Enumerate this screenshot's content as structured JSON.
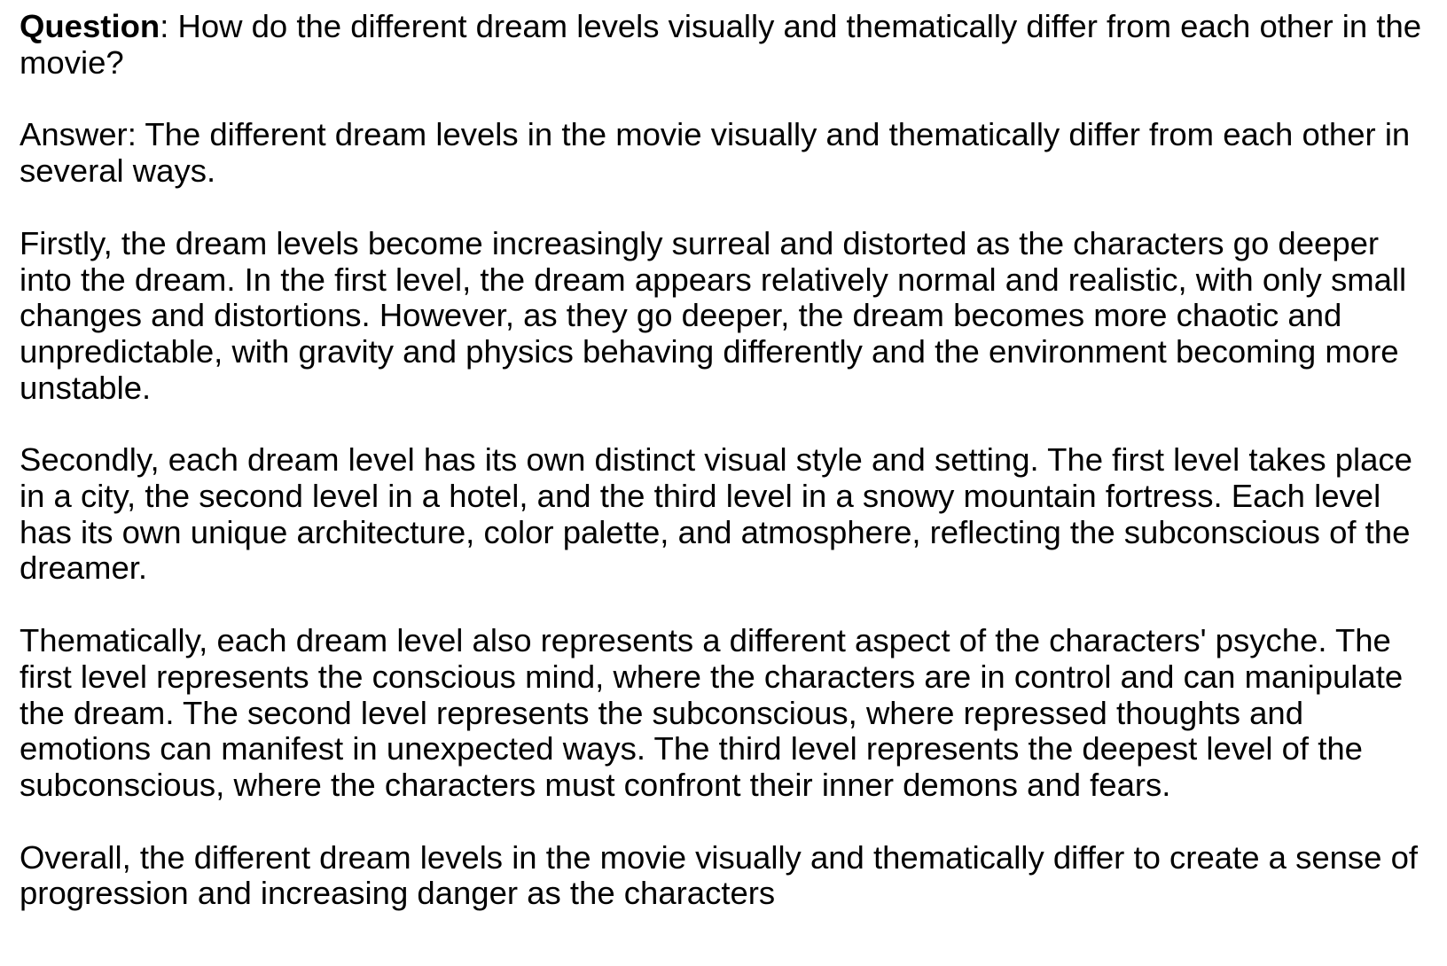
{
  "question": {
    "label": "Question",
    "text": ": How do the different dream levels visually and thematically differ from each other in the movie?"
  },
  "answer": {
    "intro": "Answer:  The different dream levels in the movie visually and thematically differ from each other in several ways.",
    "paragraphs": [
      "Firstly, the dream levels become increasingly surreal and distorted as the characters go deeper into the dream. In the first level, the dream appears relatively normal and realistic, with only small changes and distortions. However, as they go deeper, the dream becomes more chaotic and unpredictable, with gravity and physics behaving differently and the environment becoming more unstable.",
      "Secondly, each dream level has its own distinct visual style and setting. The first level takes place in a city, the second level in a hotel, and the third level in a snowy mountain fortress. Each level has its own unique architecture, color palette, and atmosphere, reflecting the subconscious of the dreamer.",
      "Thematically, each dream level also represents a different aspect of the characters' psyche. The first level represents the conscious mind, where the characters are in control and can manipulate the dream. The second level represents the subconscious, where repressed thoughts and emotions can manifest in unexpected ways. The third level represents the deepest level of the subconscious, where the characters must confront their inner demons and fears.",
      "Overall, the different dream levels in the movie visually and thematically differ to create a sense of progression and increasing danger as the characters"
    ]
  }
}
